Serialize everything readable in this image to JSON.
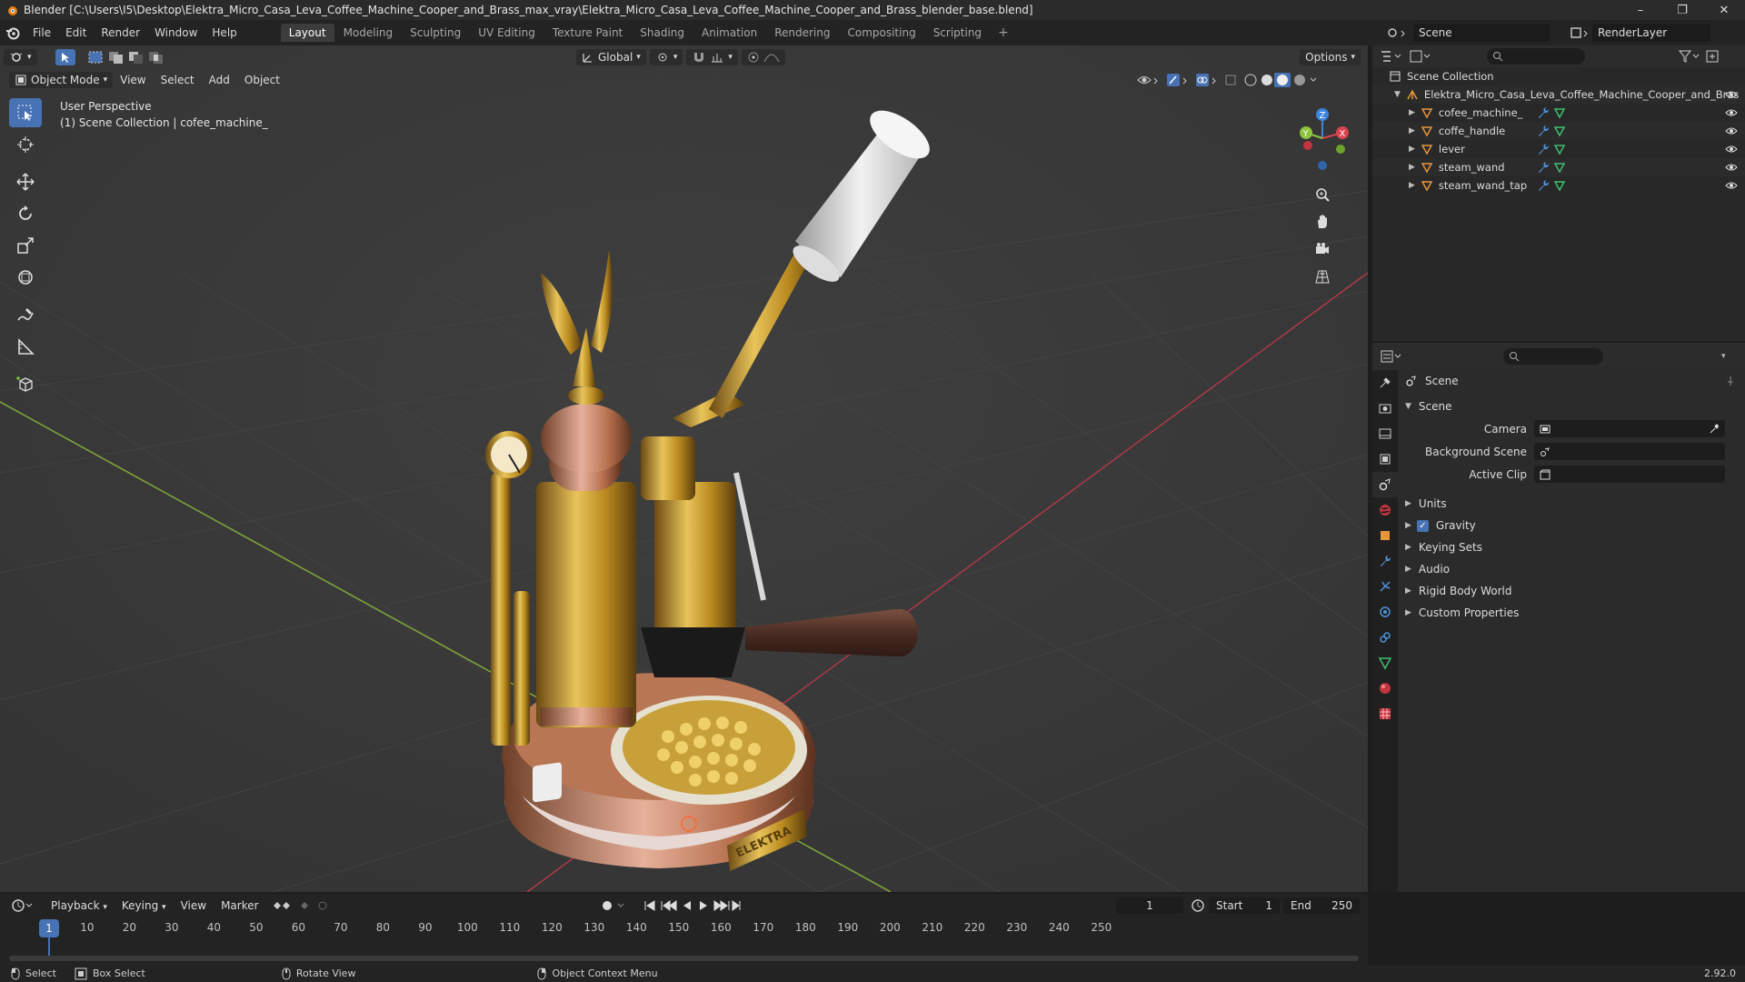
{
  "titlebar": {
    "title": "Blender [C:\\Users\\I5\\Desktop\\Elektra_Micro_Casa_Leva_Coffee_Machine_Cooper_and_Brass_max_vray\\Elektra_Micro_Casa_Leva_Coffee_Machine_Cooper_and_Brass_blender_base.blend]",
    "minimize": "–",
    "maximize": "❐",
    "close": "✕"
  },
  "menu": {
    "items": [
      "File",
      "Edit",
      "Render",
      "Window",
      "Help"
    ],
    "workspaces": [
      "Layout",
      "Modeling",
      "Sculpting",
      "UV Editing",
      "Texture Paint",
      "Shading",
      "Animation",
      "Rendering",
      "Compositing",
      "Scripting"
    ],
    "active_workspace": "Layout",
    "add": "+",
    "scene": "Scene",
    "render_layer": "RenderLayer"
  },
  "viewport": {
    "mode": "Object Mode",
    "menus": [
      "View",
      "Select",
      "Add",
      "Object"
    ],
    "orientation": "Global",
    "options": "Options",
    "perspective": "User Perspective",
    "collection_info": "(1) Scene Collection | cofee_machine_",
    "gizmo_axes": [
      "X",
      "Y",
      "Z"
    ],
    "brand_plate": "ELEKTRA"
  },
  "outliner": {
    "root": "Scene Collection",
    "collection": "Elektra_Micro_Casa_Leva_Coffee_Machine_Cooper_and_Bras",
    "objects": [
      {
        "name": "cofee_machine_"
      },
      {
        "name": "coffe_handle"
      },
      {
        "name": "lever"
      },
      {
        "name": "steam_wand"
      },
      {
        "name": "steam_wand_tap"
      }
    ]
  },
  "properties": {
    "context": "Scene",
    "panel_title": "Scene",
    "fields": [
      {
        "label": "Camera"
      },
      {
        "label": "Background Scene"
      },
      {
        "label": "Active Clip"
      }
    ],
    "subpanels": [
      "Units",
      "Gravity",
      "Keying Sets",
      "Audio",
      "Rigid Body World",
      "Custom Properties"
    ],
    "gravity_checked": true
  },
  "timeline": {
    "menus": [
      "Playback",
      "Keying",
      "View",
      "Marker"
    ],
    "current_frame": "1",
    "start_label": "Start",
    "start": "1",
    "end_label": "End",
    "end": "250",
    "ticks": [
      "10",
      "20",
      "30",
      "40",
      "50",
      "60",
      "70",
      "80",
      "90",
      "100",
      "110",
      "120",
      "130",
      "140",
      "150",
      "160",
      "170",
      "180",
      "190",
      "200",
      "210",
      "220",
      "230",
      "240",
      "250"
    ]
  },
  "statusbar": {
    "select": "Select",
    "box_select": "Box Select",
    "rotate_view": "Rotate View",
    "context_menu": "Object Context Menu",
    "version": "2.92.0"
  },
  "colors": {
    "accent": "#4772b3",
    "x_axis": "#d9434e",
    "y_axis": "#8cc43e",
    "z_axis": "#3b84e0",
    "brass": "#c9a233",
    "copper": "#c07a55"
  }
}
